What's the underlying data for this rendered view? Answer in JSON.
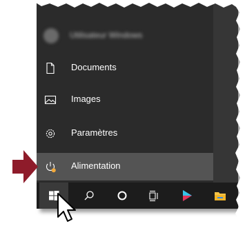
{
  "start_menu": {
    "user": {
      "display_name": "Utilisateur Windows"
    },
    "items": [
      {
        "label": "Documents",
        "icon": "document-icon"
      },
      {
        "label": "Images",
        "icon": "picture-icon"
      },
      {
        "label": "Paramètres",
        "icon": "gear-icon"
      },
      {
        "label": "Alimentation",
        "icon": "power-icon",
        "selected": true
      }
    ]
  },
  "taskbar": {
    "buttons": [
      "windows-start-icon",
      "search-icon",
      "cortana-icon",
      "task-view-icon",
      "play-store-icon",
      "file-explorer-icon"
    ]
  },
  "colors": {
    "menu_bg": "#2b2b2b",
    "selected_bg": "#545454",
    "taskbar_bg": "#1c1c1c",
    "arrow": "#8e1b2a",
    "power_badge": "#f2a93b"
  }
}
